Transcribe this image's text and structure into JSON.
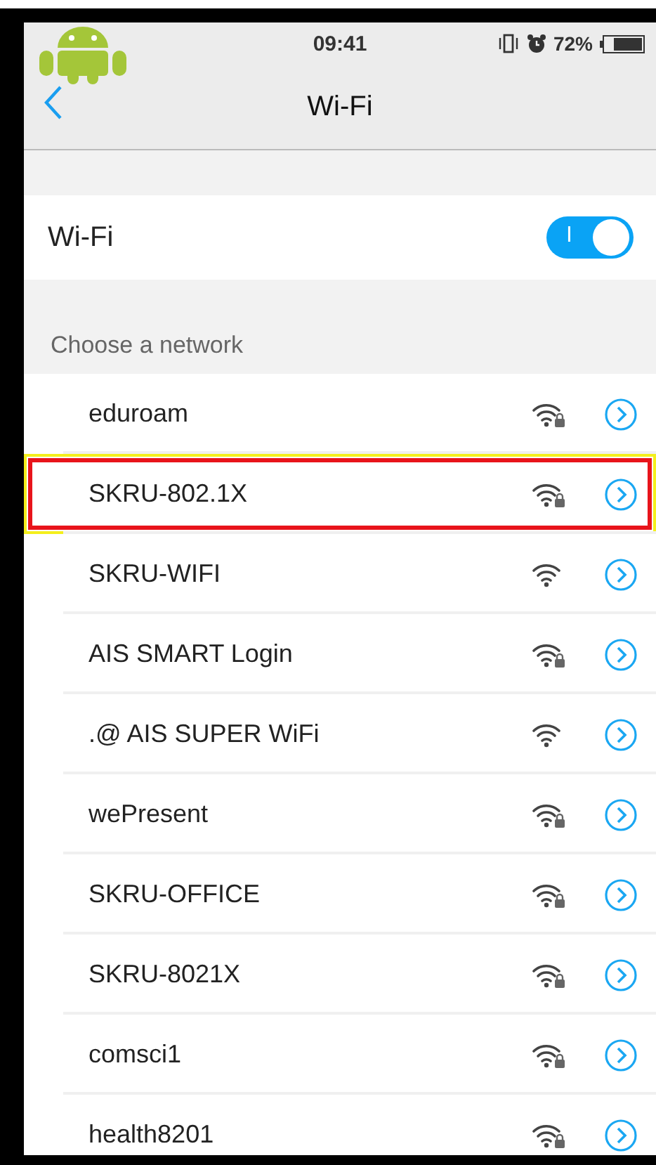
{
  "status_bar": {
    "time": "09:41",
    "battery": "72%"
  },
  "header": {
    "title": "Wi-Fi"
  },
  "wifi_toggle": {
    "label": "Wi-Fi",
    "on": true,
    "switch_text": "I"
  },
  "section_title": "Choose a network",
  "networks": [
    {
      "name": "eduroam",
      "locked": true,
      "highlighted": false
    },
    {
      "name": "SKRU-802.1X",
      "locked": true,
      "highlighted": true
    },
    {
      "name": "SKRU-WIFI",
      "locked": false,
      "highlighted": false
    },
    {
      "name": "AIS SMART Login",
      "locked": true,
      "highlighted": false
    },
    {
      "name": ".@ AIS SUPER WiFi",
      "locked": false,
      "highlighted": false
    },
    {
      "name": "wePresent",
      "locked": true,
      "highlighted": false
    },
    {
      "name": "SKRU-OFFICE",
      "locked": true,
      "highlighted": false
    },
    {
      "name": "SKRU-8021X",
      "locked": true,
      "highlighted": false
    },
    {
      "name": "comsci1",
      "locked": true,
      "highlighted": false
    },
    {
      "name": "health8201",
      "locked": true,
      "highlighted": false
    }
  ]
}
